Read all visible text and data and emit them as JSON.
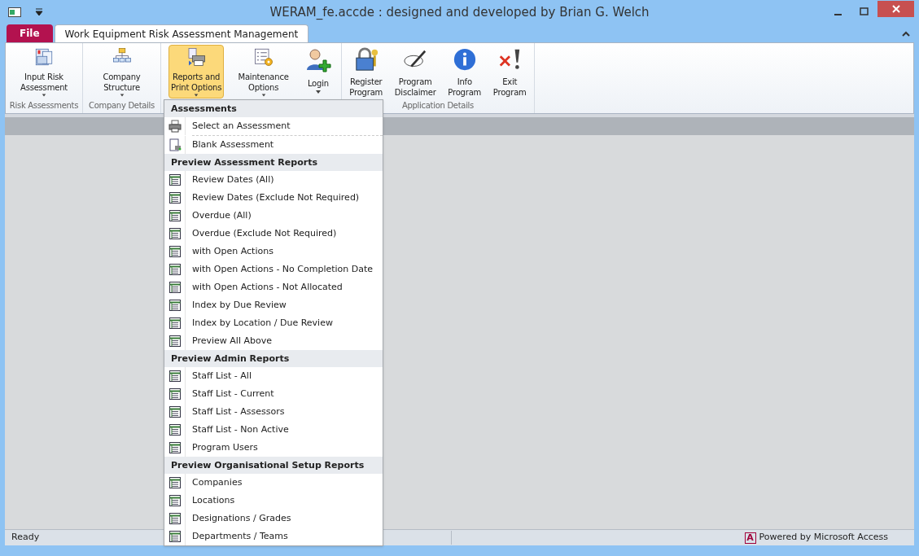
{
  "window": {
    "title": "WERAM_fe.accde : designed and developed by Brian G. Welch"
  },
  "tabs": [
    {
      "label": "File",
      "kind": "file",
      "selected": false
    },
    {
      "label": "Work Equipment Risk Assessment Management",
      "kind": "tab",
      "selected": true
    }
  ],
  "ribbon_groups": [
    {
      "label": "Risk Assessments",
      "buttons": [
        {
          "label": "Input Risk\nAssessment",
          "dropdown": true,
          "selected": false
        }
      ]
    },
    {
      "label": "Company Details",
      "buttons": [
        {
          "label": "Company\nStructure",
          "dropdown": true,
          "selected": false
        }
      ]
    },
    {
      "buttons": [
        {
          "label": "Reports and\nPrint Options",
          "dropdown": true,
          "selected": true
        },
        {
          "label": "Maintenance\nOptions",
          "dropdown": true,
          "selected": false
        },
        {
          "label": "Login",
          "dropdown": true,
          "selected": false
        }
      ]
    },
    {
      "label": "Application Details",
      "buttons": [
        {
          "label": "Register\nProgram",
          "dropdown": false,
          "selected": false
        },
        {
          "label": "Program\nDisclaimer",
          "dropdown": false,
          "selected": false
        },
        {
          "label": "Info\nProgram",
          "dropdown": false,
          "selected": false
        },
        {
          "label": "Exit\nProgram",
          "dropdown": false,
          "selected": false
        }
      ]
    }
  ],
  "menu": [
    {
      "heading": "Assessments",
      "items": [
        {
          "label": "Select an Assessment",
          "kind": "printer"
        },
        {
          "label": "Blank Assessment",
          "kind": "page"
        }
      ]
    },
    {
      "heading": "Preview Assessment Reports",
      "items": [
        {
          "label": "Review Dates (All)",
          "kind": "report"
        },
        {
          "label": "Review Dates (Exclude Not Required)",
          "kind": "report"
        },
        {
          "label": "Overdue (All)",
          "kind": "report"
        },
        {
          "label": "Overdue (Exclude Not Required)",
          "kind": "report"
        },
        {
          "label": "with Open Actions",
          "kind": "report"
        },
        {
          "label": "with Open Actions - No Completion Date",
          "kind": "report"
        },
        {
          "label": "with Open Actions - Not Allocated",
          "kind": "report"
        },
        {
          "label": "Index by Due Review",
          "kind": "report"
        },
        {
          "label": "Index by Location / Due Review",
          "kind": "report"
        },
        {
          "label": "Preview All Above",
          "kind": "report"
        }
      ]
    },
    {
      "heading": "Preview Admin Reports",
      "items": [
        {
          "label": "Staff List - All",
          "kind": "report"
        },
        {
          "label": "Staff List - Current",
          "kind": "report"
        },
        {
          "label": "Staff List - Assessors",
          "kind": "report"
        },
        {
          "label": "Staff List - Non Active",
          "kind": "report"
        },
        {
          "label": "Program Users",
          "kind": "report"
        }
      ]
    },
    {
      "heading": "Preview Organisational Setup Reports",
      "items": [
        {
          "label": "Companies",
          "kind": "report"
        },
        {
          "label": "Locations",
          "kind": "report"
        },
        {
          "label": "Designations / Grades",
          "kind": "report"
        },
        {
          "label": "Departments / Teams",
          "kind": "report"
        }
      ]
    }
  ],
  "status_bar": {
    "left": "Ready",
    "right": "Powered by Microsoft Access",
    "logo": "A"
  }
}
